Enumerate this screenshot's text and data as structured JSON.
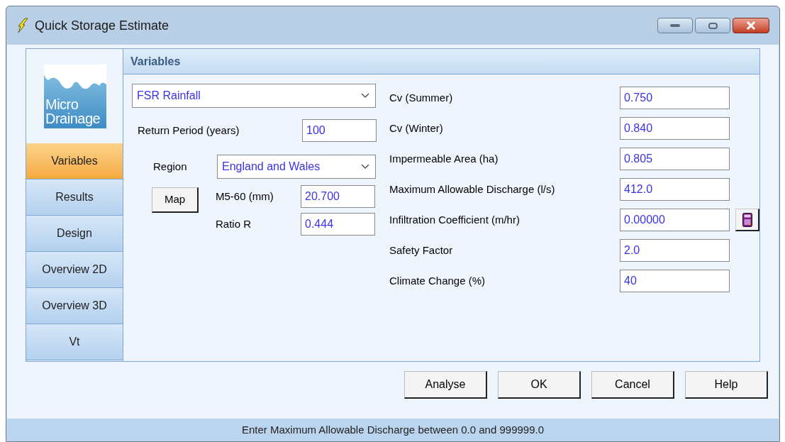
{
  "window": {
    "title": "Quick Storage Estimate"
  },
  "logo": {
    "lines": [
      "Micro",
      "Drainage"
    ]
  },
  "tabs": [
    {
      "label": "Variables",
      "selected": true
    },
    {
      "label": "Results",
      "selected": false
    },
    {
      "label": "Design",
      "selected": false
    },
    {
      "label": "Overview 2D",
      "selected": false
    },
    {
      "label": "Overview 3D",
      "selected": false
    },
    {
      "label": "Vt",
      "selected": false
    }
  ],
  "panel": {
    "title": "Variables",
    "rainfall": {
      "value": "FSR Rainfall"
    },
    "return_period": {
      "label": "Return Period (years)",
      "value": "100"
    },
    "region": {
      "label": "Region",
      "value": "England and Wales"
    },
    "map_button": "Map",
    "m5_60": {
      "label": "M5-60 (mm)",
      "value": "20.700"
    },
    "ratio_r": {
      "label": "Ratio R",
      "value": "0.444"
    },
    "fields": [
      {
        "label": "Cv (Summer)",
        "value": "0.750"
      },
      {
        "label": "Cv (Winter)",
        "value": "0.840"
      },
      {
        "label": "Impermeable Area (ha)",
        "value": "0.805"
      },
      {
        "label": "Maximum Allowable Discharge (l/s)",
        "value": "412.0"
      },
      {
        "label": "Infiltration Coefficient (m/hr)",
        "value": "0.00000",
        "calculator": true
      },
      {
        "label": "Safety Factor",
        "value": "2.0"
      },
      {
        "label": "Climate Change (%)",
        "value": "40"
      }
    ]
  },
  "buttons": [
    "Analyse",
    "OK",
    "Cancel",
    "Help"
  ],
  "status_bar": "Enter Maximum Allowable Discharge between 0.0 and 999999.0"
}
